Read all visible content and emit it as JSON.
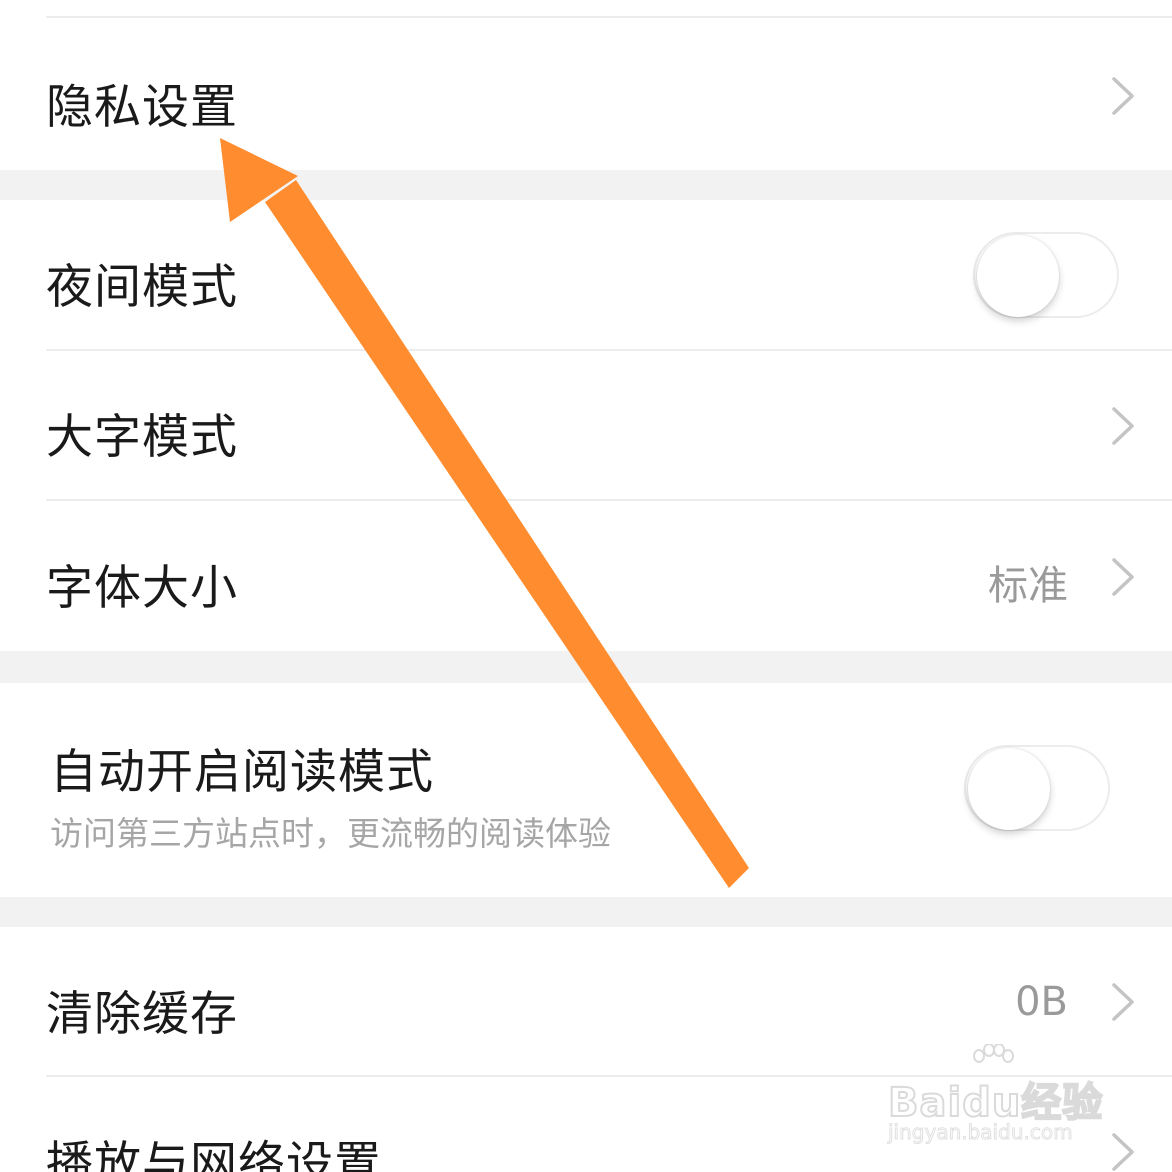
{
  "settings": {
    "privacy": {
      "label": "隐私设置"
    },
    "night_mode": {
      "label": "夜间模式",
      "enabled": false
    },
    "large_text": {
      "label": "大字模式"
    },
    "font_size": {
      "label": "字体大小",
      "value": "标准"
    },
    "auto_reader": {
      "label": "自动开启阅读模式",
      "description": "访问第三方站点时，更流畅的阅读体验",
      "enabled": false
    },
    "clear_cache": {
      "label": "清除缓存",
      "value": "0B"
    },
    "playback_network": {
      "label": "播放与网络设置"
    }
  },
  "icons": {
    "chevron": "chevron-right-icon",
    "toggle": "toggle-switch"
  },
  "colors": {
    "annotation_arrow": "#FF8C2E",
    "section_gap": "#F2F2F2",
    "divider": "#ECECEC",
    "label_text": "#1A1A1A",
    "secondary_text": "#9A9A9A"
  },
  "watermark": {
    "logo": "Baidu经验",
    "url": "jingyan.baidu.com"
  }
}
